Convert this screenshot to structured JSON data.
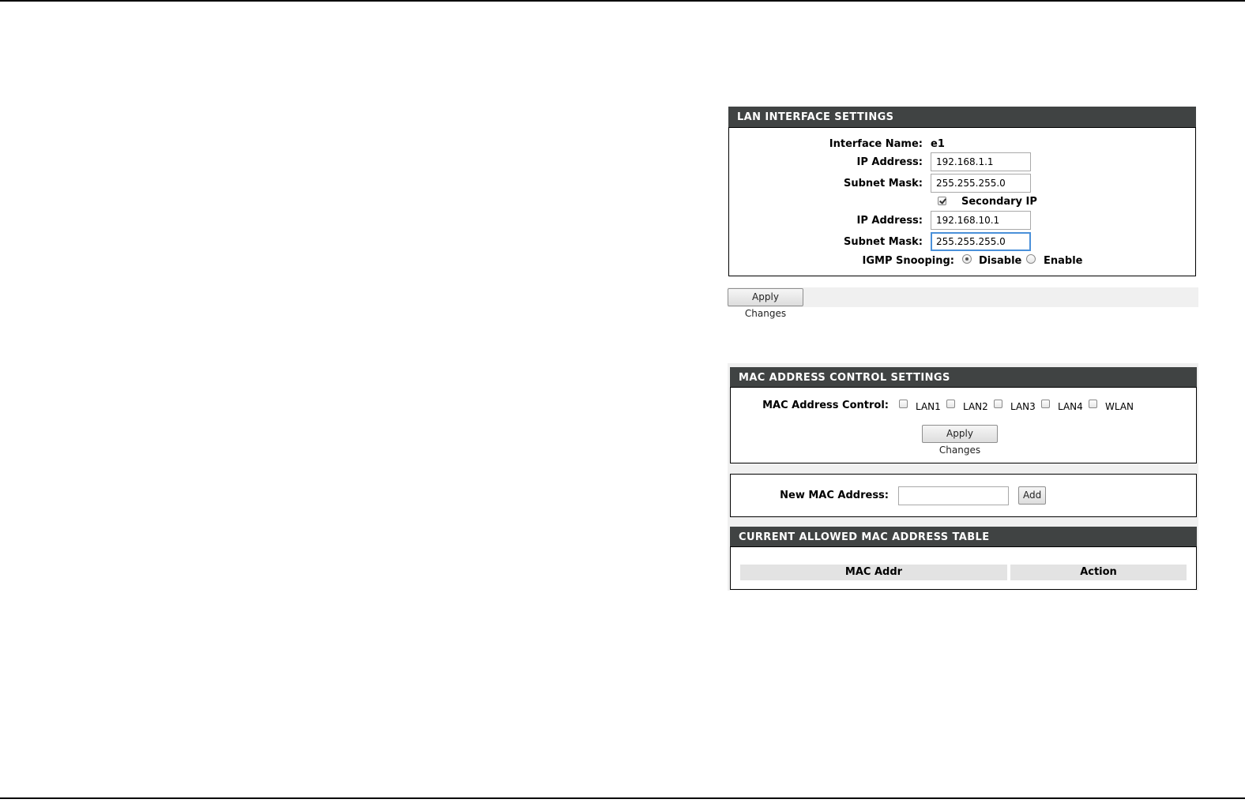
{
  "lan_interface": {
    "header": "LAN INTERFACE SETTINGS",
    "interface_name_label": "Interface Name:",
    "interface_name_value": "e1",
    "ip_label": "IP Address:",
    "ip_value": "192.168.1.1",
    "subnet_label": "Subnet Mask:",
    "subnet_value": "255.255.255.0",
    "secondary_ip_label": "Secondary IP",
    "secondary_ip_checked": true,
    "secondary_ip_address_label": "IP Address:",
    "secondary_ip_address_value": "192.168.10.1",
    "secondary_subnet_label": "Subnet Mask:",
    "secondary_subnet_value": "255.255.255.0",
    "igmp_label": "IGMP Snooping:",
    "igmp_options": [
      "Disable",
      "Enable"
    ],
    "igmp_selected": "Disable",
    "apply_label": "Apply Changes"
  },
  "mac_control": {
    "header": "MAC ADDRESS CONTROL SETTINGS",
    "control_label": "MAC Address Control:",
    "ports": [
      "LAN1",
      "LAN2",
      "LAN3",
      "LAN4",
      "WLAN"
    ],
    "apply_label": "Apply Changes",
    "new_mac_label": "New MAC Address:",
    "new_mac_value": "",
    "add_label": "Add"
  },
  "allowed_table": {
    "header": "CURRENT ALLOWED MAC ADDRESS TABLE",
    "columns": [
      "MAC Addr",
      "Action"
    ],
    "rows": []
  }
}
